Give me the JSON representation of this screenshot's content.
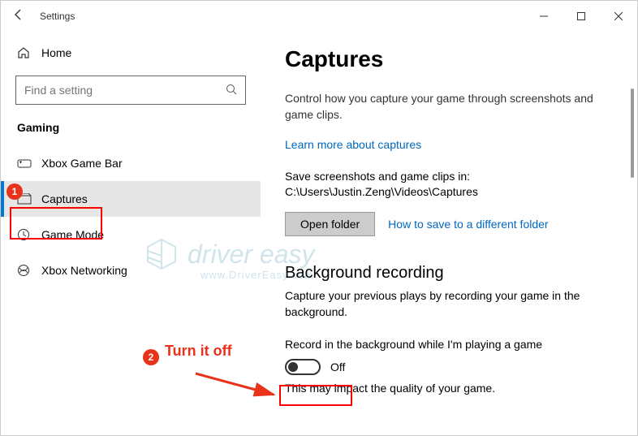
{
  "titlebar": {
    "title": "Settings"
  },
  "sidebar": {
    "home": "Home",
    "search_placeholder": "Find a setting",
    "group": "Gaming",
    "items": [
      {
        "label": "Xbox Game Bar"
      },
      {
        "label": "Captures"
      },
      {
        "label": "Game Mode"
      },
      {
        "label": "Xbox Networking"
      }
    ]
  },
  "content": {
    "title": "Captures",
    "desc": "Control how you capture your game through screenshots and game clips.",
    "learn_link": "Learn more about captures",
    "save_line": "Save screenshots and game clips in: C:\\Users\\Justin.Zeng\\Videos\\Captures",
    "open_folder": "Open folder",
    "howto_link": "How to save to a different folder",
    "bg_heading": "Background recording",
    "bg_desc": "Capture your previous plays by recording your game in the background.",
    "toggle_label": "Record in the background while I'm playing a game",
    "toggle_state": "Off",
    "footnote": "This may impact the quality of your game."
  },
  "annotations": {
    "badge1": "1",
    "badge2": "2",
    "text": "Turn it off"
  },
  "watermark": {
    "brand": "driver easy",
    "url": "www.DriverEasy.com"
  }
}
